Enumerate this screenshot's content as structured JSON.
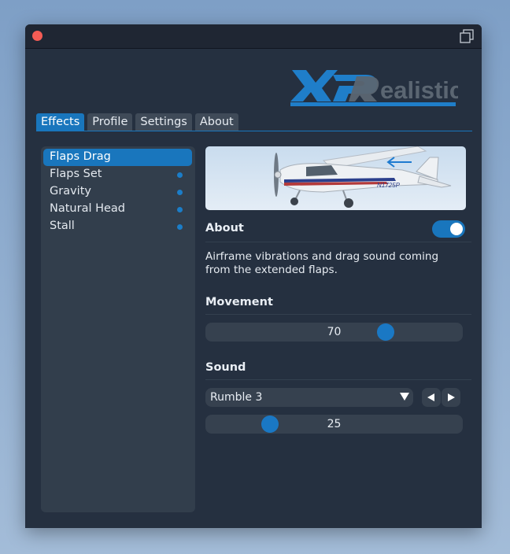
{
  "window": {
    "logo_text": "XPRealistic"
  },
  "tabs": [
    {
      "label": "Effects",
      "active": true
    },
    {
      "label": "Profile",
      "active": false
    },
    {
      "label": "Settings",
      "active": false
    },
    {
      "label": "About",
      "active": false
    }
  ],
  "sidebar": {
    "items": [
      {
        "label": "Flaps Drag",
        "selected": true,
        "enabled": true
      },
      {
        "label": "Flaps Set",
        "selected": false,
        "enabled": true
      },
      {
        "label": "Gravity",
        "selected": false,
        "enabled": true
      },
      {
        "label": "Natural Head",
        "selected": false,
        "enabled": true
      },
      {
        "label": "Stall",
        "selected": false,
        "enabled": true
      }
    ]
  },
  "effect": {
    "image_registration": "N1725P",
    "about": {
      "title": "About",
      "enabled": true,
      "description": "Airframe vibrations and drag sound coming from the extended flaps."
    },
    "movement": {
      "title": "Movement",
      "value": "70",
      "fraction": 0.7
    },
    "sound": {
      "title": "Sound",
      "selected": "Rumble 3",
      "value": "25",
      "fraction": 0.25
    }
  },
  "colors": {
    "accent": "#1976bd",
    "window_bg": "#253040",
    "panel_bg": "#323e4c",
    "close": "#f45c55"
  },
  "icons": [
    "close-dot-icon",
    "popout-window-icon",
    "toggle-icon",
    "chevron-down-icon",
    "arrow-left-icon",
    "arrow-right-icon"
  ]
}
